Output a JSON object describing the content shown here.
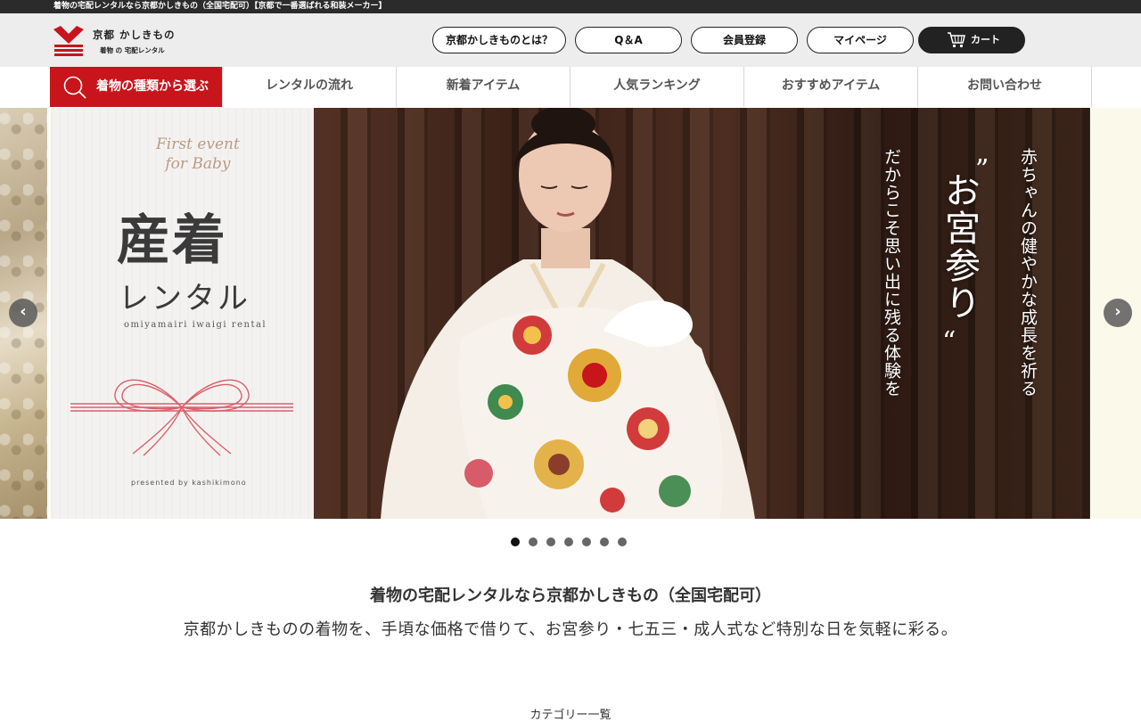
{
  "topbar": {
    "text": "着物の宅配レンタルなら京都かしきもの（全国宅配可）【京都で一番選ばれる和装メーカー】"
  },
  "logo": {
    "main": "京都 かしきもの",
    "sub": "着物 の 宅配レンタル"
  },
  "header_buttons": [
    {
      "label": "京都かしきものとは？"
    },
    {
      "label": "Q＆A"
    },
    {
      "label": "会員登録"
    },
    {
      "label": "マイページ"
    },
    {
      "label": "カート"
    }
  ],
  "nav": {
    "search_label": "着物の種類から選ぶ",
    "items": [
      {
        "label": "レンタルの流れ"
      },
      {
        "label": "新着アイテム"
      },
      {
        "label": "人気ランキング"
      },
      {
        "label": "おすすめアイテム"
      },
      {
        "label": "お問い合わせ"
      }
    ]
  },
  "hero": {
    "script_line1": "First event",
    "script_line2": "for Baby",
    "title": "産着",
    "title2": "レンタル",
    "roman": "omiyamairi iwaigi rental",
    "presented": "presented by kashikimono",
    "vertical_right": "赤ちゃんの健やかな成長を祈る",
    "vertical_center": "お宮参り",
    "vertical_left": "だからこそ思い出に残る体験を",
    "quote_open": "”",
    "quote_close": "“",
    "slide_count": 7,
    "active_slide": 1
  },
  "arrows": {
    "prev": "‹",
    "next": "›"
  },
  "intro": {
    "tagline": "着物の宅配レンタルなら京都かしきもの（全国宅配可）",
    "lead": "京都かしきものの着物を、手頃な価格で借りて、お宮参り・七五三・成人式など特別な日を気軽に彩る。",
    "next_heading": "カテゴリー一覧"
  },
  "colors": {
    "brand_red": "#c8141b",
    "topbar": "#2b2b2b",
    "header_bg": "#ededed"
  }
}
